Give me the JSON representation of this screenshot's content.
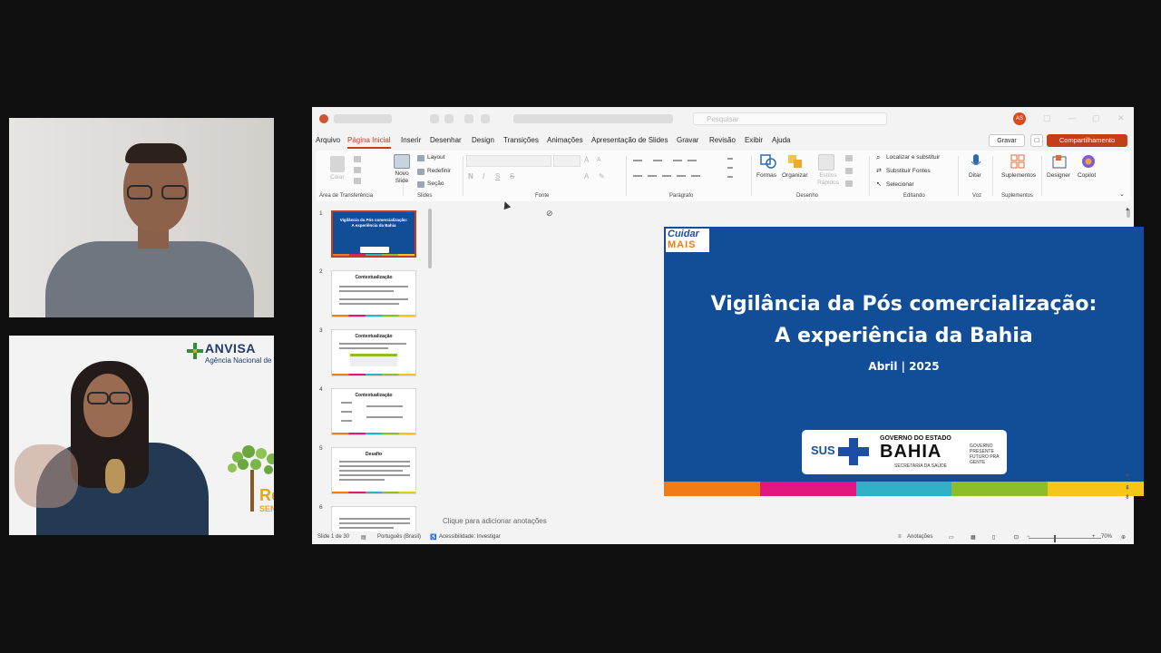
{
  "colors": {
    "accent": "#c43e1c",
    "slide_bg": "#114e97",
    "bar_orange": "#f07c14",
    "bar_pink": "#e1187b",
    "bar_teal": "#2eb0c7",
    "bar_green": "#8dbd2a",
    "bar_yellow": "#f5c518"
  },
  "participants": {
    "tile2": {
      "anvisa_title": "ANVISA",
      "anvisa_subtitle": "Agência Nacional de Vigilâ",
      "logo_text": "Re",
      "logo_sub": "SENT"
    }
  },
  "titlebar": {
    "search_placeholder": "Pesquisar",
    "avatar_initials": "AS"
  },
  "menu": {
    "items": [
      "Arquivo",
      "Página Inicial",
      "Inserir",
      "Desenhar",
      "Design",
      "Transições",
      "Animações",
      "Apresentação de Slides",
      "Gravar",
      "Revisão",
      "Exibir",
      "Ajuda"
    ],
    "record_label": "Gravar",
    "share_label": "Compartilhamento"
  },
  "ribbon": {
    "clipboard": {
      "paste": "Colar",
      "group": "Área de Transferência"
    },
    "slides": {
      "new_slide": "Novo Slide",
      "layout": "Layout",
      "reset": "Redefinir",
      "section": "Seção",
      "group": "Slides"
    },
    "font": {
      "bold": "N",
      "italic": "I",
      "underline": "S",
      "strike": "S",
      "group": "Fonte"
    },
    "paragraph": {
      "group": "Parágrafo"
    },
    "drawing": {
      "shapes": "Formas",
      "arrange": "Organizar",
      "quick_styles": "Estilos Rápidos",
      "group": "Desenho"
    },
    "editing": {
      "find": "Localizar e substituir",
      "replace_fonts": "Substituir Fontes",
      "select": "Selecionar",
      "group": "Editando"
    },
    "voice": {
      "dictate": "Ditar",
      "group": "Voz"
    },
    "addins": {
      "addins": "Suplementos",
      "group": "Suplementos"
    },
    "designer": "Designer",
    "copilot": "Copilot"
  },
  "thumbnails": [
    {
      "num": "1",
      "title": "Vigilância da Pós comercialização: A experiência da Bahia"
    },
    {
      "num": "2",
      "title": "Contextualização"
    },
    {
      "num": "3",
      "title": "Contextualização"
    },
    {
      "num": "4",
      "title": "Contextualização"
    },
    {
      "num": "5",
      "title": "Desafio"
    },
    {
      "num": "6",
      "title": ""
    }
  ],
  "slide": {
    "logo_line1": "Cuidar",
    "logo_line2": "MAIS",
    "title_line1": "Vigilância da Pós comercialização:",
    "title_line2": "A experiência da Bahia",
    "date": "Abril | 2025",
    "sus": "SUS",
    "gov_line1": "GOVERNO DO ESTADO",
    "gov_line2": "BAHIA",
    "gov_line3": "SECRETARIA DA SAÚDE",
    "gov_line4": "GOVERNO PRESENTE FUTURO PRA GENTE"
  },
  "notes_placeholder": "Clique para adicionar anotações",
  "status": {
    "slide_counter": "Slide 1 de 30",
    "language": "Português (Brasil)",
    "accessibility": "Acessibilidade: Investigar",
    "notes": "Anotações",
    "zoom": "70%"
  }
}
